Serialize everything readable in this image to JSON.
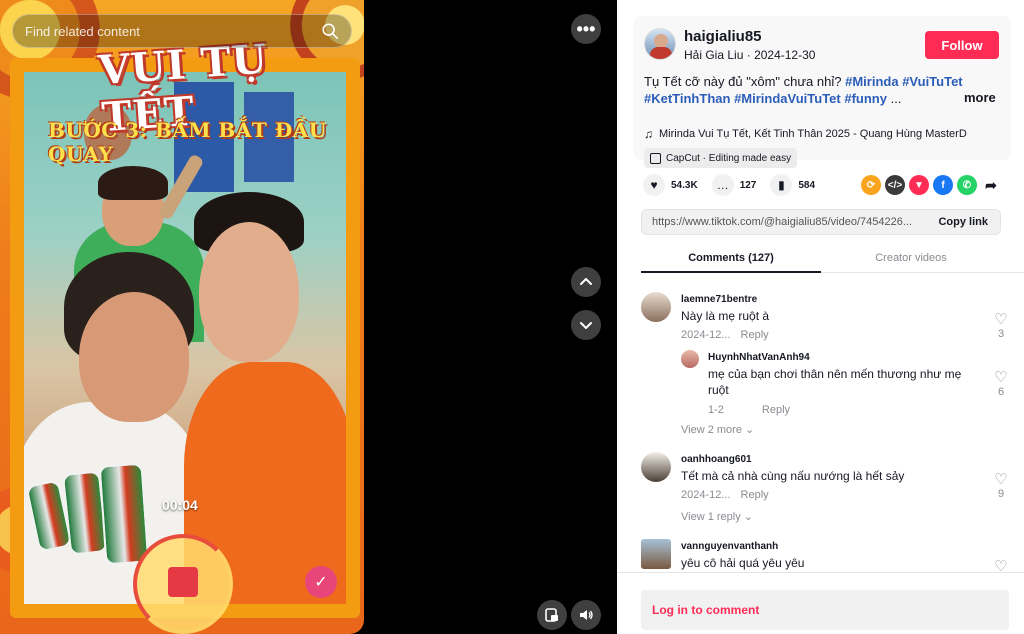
{
  "search": {
    "placeholder": "Find related content"
  },
  "video": {
    "title_overlay": "VUI TỤ TẾT",
    "step_overlay": "BƯỚC 3: BẤM BẮT ĐẦU QUAY",
    "timer": "00:04",
    "more_icon": "more-horizontal-icon",
    "check_icon": "check-icon"
  },
  "post": {
    "handle": "haigialiu85",
    "display_name": "Hải Gia Liu",
    "date": "2024-12-30",
    "follow_label": "Follow",
    "caption_text": "Tụ Tết cỡ này đủ \"xôm\" chưa nhỉ?",
    "hashtags_line1": [
      "#Mirinda",
      "#VuiTuTet"
    ],
    "hashtags_line2": [
      "#KetTinhThan",
      "#MirindaVuiTuTet",
      "#funny"
    ],
    "ellipsis": "...",
    "more_label": "more",
    "music": "Mirinda Vui Tụ Tết, Kết Tinh Thân 2025 - Quang Hùng MasterD",
    "capcut": "CapCut · Editing made easy"
  },
  "stats": {
    "likes": "54.3K",
    "comments": "127",
    "saves": "584"
  },
  "share": {
    "icons": [
      "repost-icon",
      "embed-icon",
      "pinterest-icon",
      "facebook-icon",
      "whatsapp-icon",
      "share-arrow-icon"
    ],
    "colors": [
      "#f9a41e",
      "#3a3a3a",
      "#fe2c55",
      "#1877f2",
      "#25d366",
      "#161823"
    ]
  },
  "link": {
    "url": "https://www.tiktok.com/@haigialiu85/video/7454226...",
    "copy_label": "Copy link"
  },
  "tabs": [
    {
      "label": "Comments (127)"
    },
    {
      "label": "Creator videos"
    }
  ],
  "comments": [
    {
      "user": "laemne71bentre",
      "text": "Này là mẹ ruột à",
      "date": "2024-12...",
      "reply": "Reply",
      "likes": "3"
    },
    {
      "user": "HuynhNhatVanAnh94",
      "text": "mẹ của bạn chơi thân nên mến thương như mẹ ruột",
      "date": "1-2",
      "reply": "Reply",
      "likes": "6"
    },
    {
      "user": "oanhhoang601",
      "text": "Tết mà cả nhà cùng nấu nướng là hết sảy",
      "date": "2024-12...",
      "reply": "Reply",
      "likes": "9"
    },
    {
      "user": "vannguyenvanthanh",
      "text": "yêu cô hải quá yêu yêu"
    }
  ],
  "view_more": [
    "View 2 more",
    "View 1 reply"
  ],
  "login": {
    "label": "Log in to comment"
  },
  "colors": {
    "accent": "#fe2c55",
    "hashtag": "#2b5db9",
    "muted": "#8a8b91",
    "text": "#161823"
  }
}
